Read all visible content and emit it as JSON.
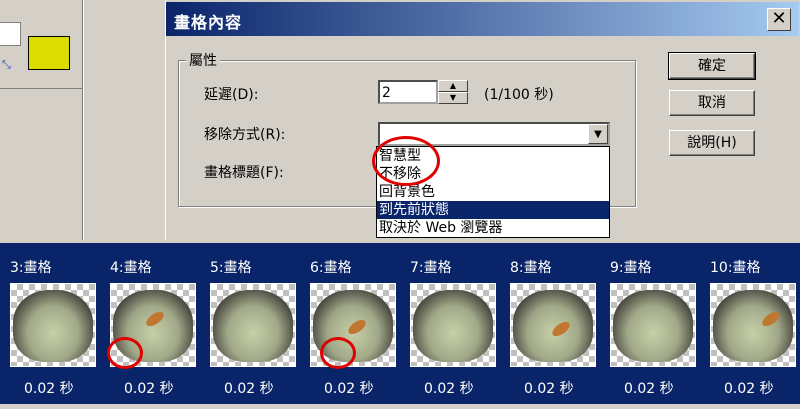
{
  "dialog": {
    "title": "畫格內容",
    "close_glyph": "✕",
    "group_label": "屬性",
    "delay_label": "延遲(D):",
    "delay_value": "2",
    "delay_unit": "(1/100 秒)",
    "removal_label": "移除方式(R):",
    "frame_title_label": "畫格標題(F):",
    "removal_options": [
      {
        "label": "智慧型",
        "selected": false
      },
      {
        "label": "不移除",
        "selected": false
      },
      {
        "label": "回背景色",
        "selected": false
      },
      {
        "label": "到先前狀態",
        "selected": true
      },
      {
        "label": "取決於 Web 瀏覽器",
        "selected": false
      }
    ],
    "buttons": {
      "ok": "確定",
      "cancel": "取消",
      "help": "說明(H)"
    }
  },
  "filmstrip": {
    "frames": [
      {
        "label": "3:畫格",
        "delay": "0.02 秒"
      },
      {
        "label": "4:畫格",
        "delay": "0.02 秒"
      },
      {
        "label": "5:畫格",
        "delay": "0.02 秒"
      },
      {
        "label": "6:畫格",
        "delay": "0.02 秒"
      },
      {
        "label": "7:畫格",
        "delay": "0.02 秒"
      },
      {
        "label": "8:畫格",
        "delay": "0.02 秒"
      },
      {
        "label": "9:畫格",
        "delay": "0.02 秒"
      },
      {
        "label": "10:畫格",
        "delay": "0.02 秒"
      }
    ]
  },
  "colors": {
    "titlebar": "#0a246a",
    "highlight": "#0a246a",
    "annotation": "#e00000",
    "swatch": "#dcdc00"
  }
}
